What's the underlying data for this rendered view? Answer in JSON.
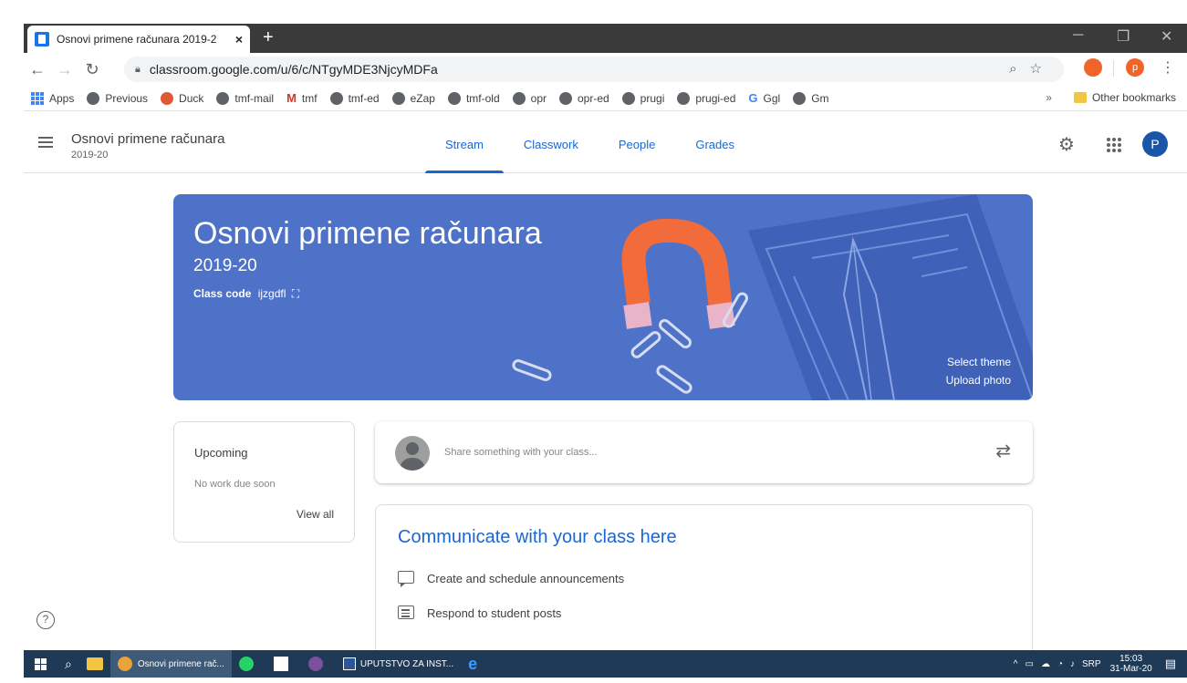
{
  "browser": {
    "tab_title": "Osnovi primene računara 2019-2",
    "tab_close": "×",
    "new_tab": "+",
    "url": "classroom.google.com/u/6/c/NTgyMDE3NjcyMDFa",
    "profile_letter": "p",
    "bookmarks": [
      {
        "label": "Apps",
        "icon": "apps-grid-icon"
      },
      {
        "label": "Previous",
        "icon": "globe-icon"
      },
      {
        "label": "Duck",
        "icon": "duck-icon"
      },
      {
        "label": "tmf-mail",
        "icon": "globe-icon"
      },
      {
        "label": "tmf",
        "icon": "gmail-icon"
      },
      {
        "label": "tmf-ed",
        "icon": "globe-icon"
      },
      {
        "label": "eZap",
        "icon": "globe-icon"
      },
      {
        "label": "tmf-old",
        "icon": "globe-icon"
      },
      {
        "label": "opr",
        "icon": "globe-icon"
      },
      {
        "label": "opr-ed",
        "icon": "globe-icon"
      },
      {
        "label": "prugi",
        "icon": "globe-icon"
      },
      {
        "label": "prugi-ed",
        "icon": "globe-icon"
      },
      {
        "label": "Ggl",
        "icon": "google-icon"
      },
      {
        "label": "Gm",
        "icon": "globe-icon"
      }
    ],
    "bookmarks_overflow": "»",
    "other_bookmarks": "Other bookmarks"
  },
  "header": {
    "class_name": "Osnovi primene računara",
    "section": "2019-20",
    "tabs": [
      {
        "label": "Stream",
        "active": true
      },
      {
        "label": "Classwork",
        "active": false
      },
      {
        "label": "People",
        "active": false
      },
      {
        "label": "Grades",
        "active": false
      }
    ],
    "avatar_letter": "P"
  },
  "banner": {
    "title": "Osnovi primene računara",
    "year": "2019-20",
    "class_code_label": "Class code",
    "class_code": "ijzgdfl",
    "select_theme": "Select theme",
    "upload_photo": "Upload photo"
  },
  "upcoming": {
    "title": "Upcoming",
    "empty": "No work due soon",
    "view_all": "View all"
  },
  "share": {
    "placeholder": "Share something with your class..."
  },
  "communicate": {
    "title": "Communicate with your class here",
    "items": [
      {
        "label": "Create and schedule announcements",
        "icon": "chat-bubble-icon"
      },
      {
        "label": "Respond to student posts",
        "icon": "list-icon"
      }
    ]
  },
  "help": "?",
  "taskbar": {
    "chrome_item": "Osnovi primene rač...",
    "word_item": "UPUTSTVO ZA INST...",
    "language": "SRP",
    "time": "15:03",
    "date": "31-Mar-20"
  },
  "colors": {
    "banner": "#4d72c8",
    "accent": "#1967d2",
    "taskbar": "#1f3a56"
  }
}
